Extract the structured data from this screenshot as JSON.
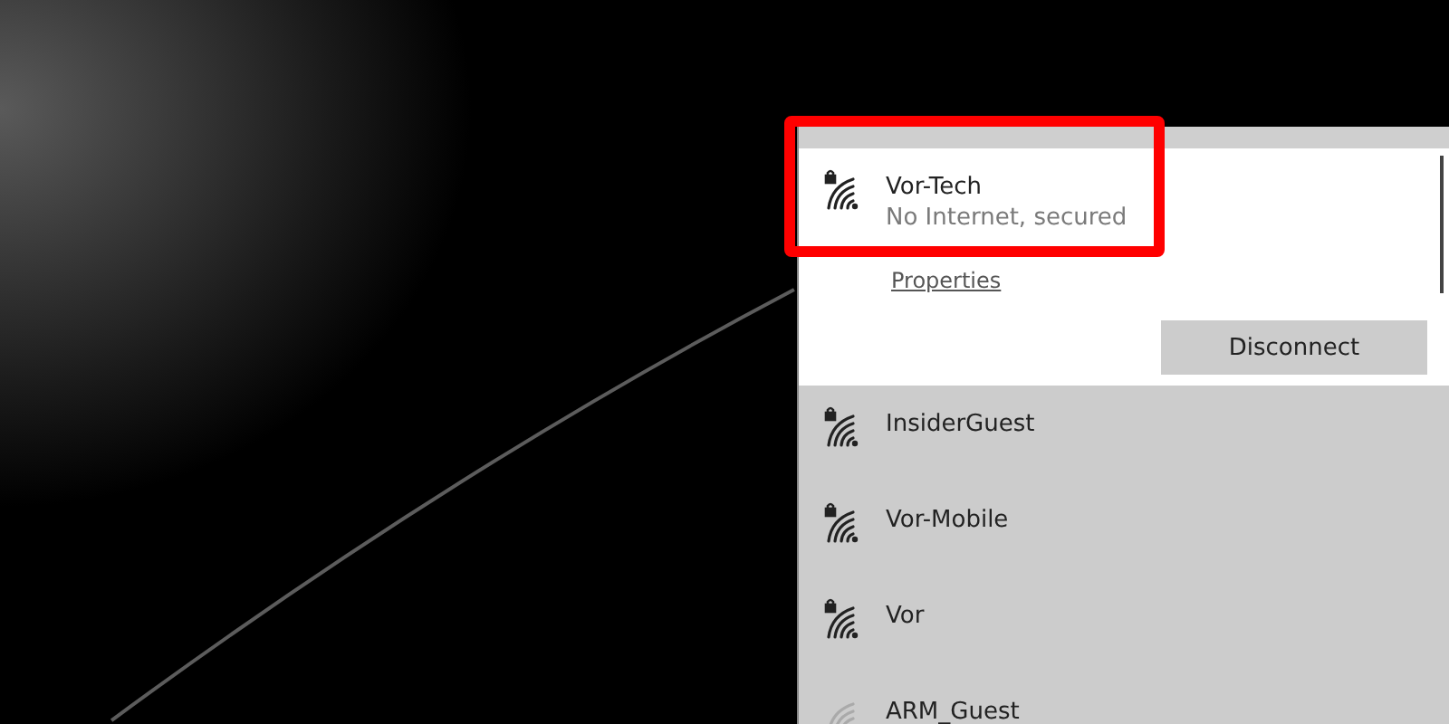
{
  "networks": [
    {
      "name": "Vor-Tech",
      "status": "No Internet, secured",
      "secured": true,
      "selected": true,
      "highlighted": true,
      "link": "Properties",
      "button": "Disconnect"
    },
    {
      "name": "InsiderGuest",
      "secured": true,
      "selected": false,
      "highlighted": false
    },
    {
      "name": "Vor-Mobile",
      "secured": true,
      "selected": false,
      "highlighted": false
    },
    {
      "name": "Vor",
      "secured": true,
      "selected": false,
      "highlighted": false
    },
    {
      "name": "ARM_Guest",
      "secured": false,
      "selected": false,
      "highlighted": false
    }
  ]
}
